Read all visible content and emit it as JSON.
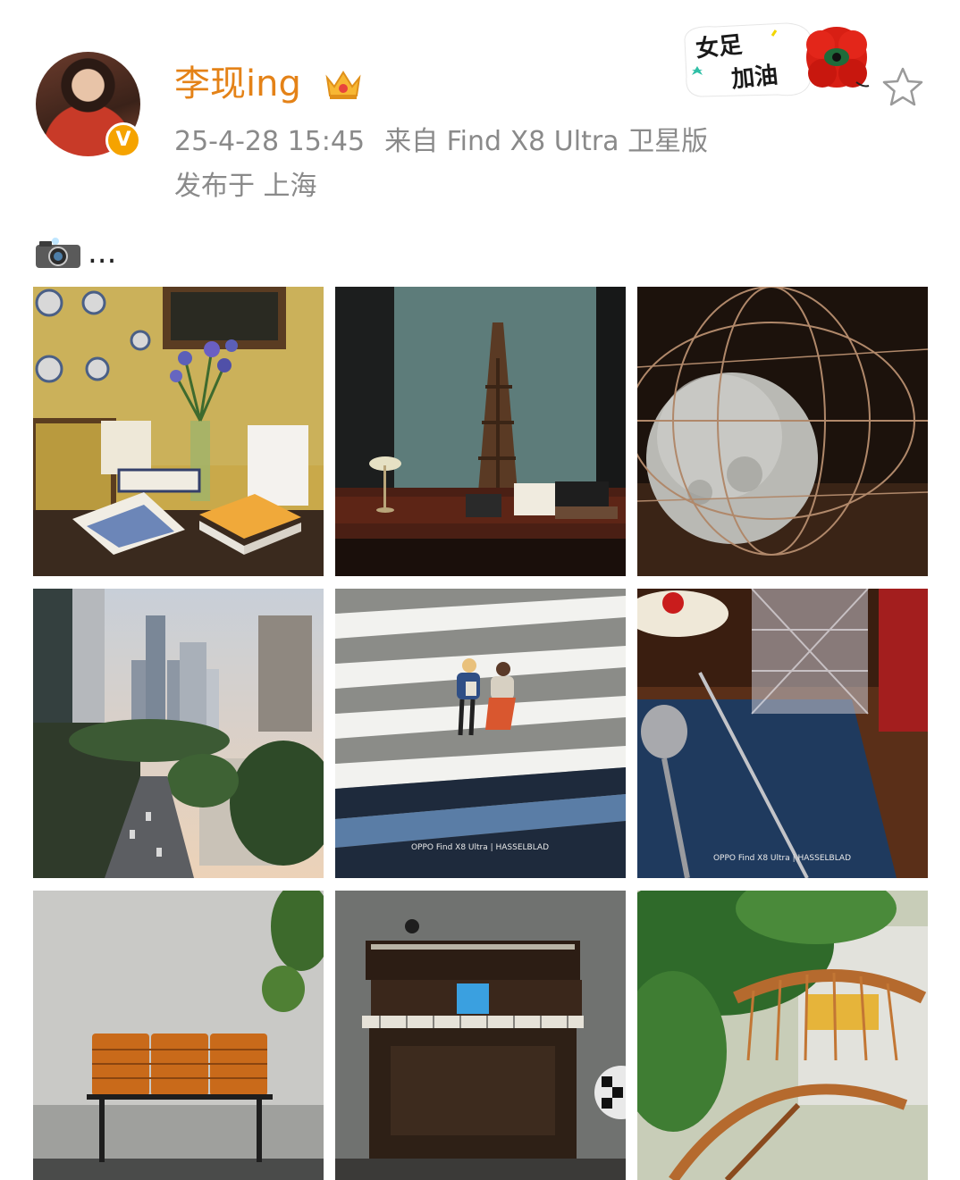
{
  "post": {
    "username": "李现ing",
    "verified_badge": "V",
    "timestamp": "25-4-28 15:45",
    "source": "来自 Find X8 Ultra 卫星版",
    "location": "发布于 上海",
    "text": "...",
    "sticker_line1": "女足",
    "sticker_line2": "加油"
  },
  "icons": [
    "avatar",
    "crown-icon",
    "verified-v-icon",
    "women-football-sticker",
    "flower-sticker",
    "favorite-star-icon",
    "camera-flash-emoji"
  ],
  "photos": [
    {
      "subject": "interior-books-irises",
      "watermark": ""
    },
    {
      "subject": "desk-lamp-bookshelf",
      "watermark": ""
    },
    {
      "subject": "globe-sculpture",
      "watermark": ""
    },
    {
      "subject": "city-skyline",
      "watermark": ""
    },
    {
      "subject": "crosswalk-couple",
      "watermark": "OPPO Find X8 Ultra | HASSELBLAD"
    },
    {
      "subject": "glass-spoon-table",
      "watermark": "OPPO Find X8 Ultra | HASSELBLAD"
    },
    {
      "subject": "orange-bench",
      "watermark": ""
    },
    {
      "subject": "piano",
      "watermark": ""
    },
    {
      "subject": "tree-balcony",
      "watermark": ""
    }
  ]
}
